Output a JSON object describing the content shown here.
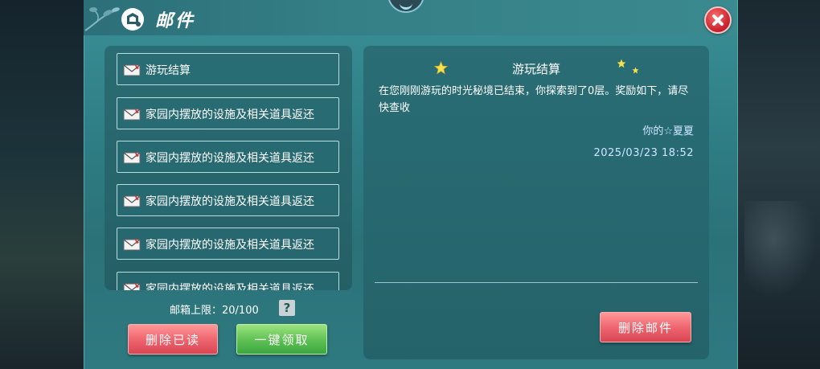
{
  "header": {
    "title": "邮件"
  },
  "mail_list": [
    {
      "subject": "游玩结算"
    },
    {
      "subject": "家园内摆放的设施及相关道具返还"
    },
    {
      "subject": "家园内摆放的设施及相关道具返还"
    },
    {
      "subject": "家园内摆放的设施及相关道具返还"
    },
    {
      "subject": "家园内摆放的设施及相关道具返还"
    },
    {
      "subject": "家园内摆放的设施及相关道具返还"
    }
  ],
  "footer": {
    "capacity_text": "邮箱上限：20/100",
    "help_label": "?",
    "delete_read_label": "删除已读",
    "claim_all_label": "一键领取"
  },
  "detail": {
    "subject": "游玩结算",
    "body": "在您刚刚游玩的时光秘境已结束，你探索到了0层。奖励如下，请尽快查收",
    "sender": "你的☆夏夏",
    "date": "2025/03/23 18:52",
    "delete_label": "删除邮件"
  },
  "colors": {
    "panel": "#2f7f86",
    "button_red": "#ef6670",
    "button_green": "#61c355",
    "close_red": "#c3202a"
  }
}
